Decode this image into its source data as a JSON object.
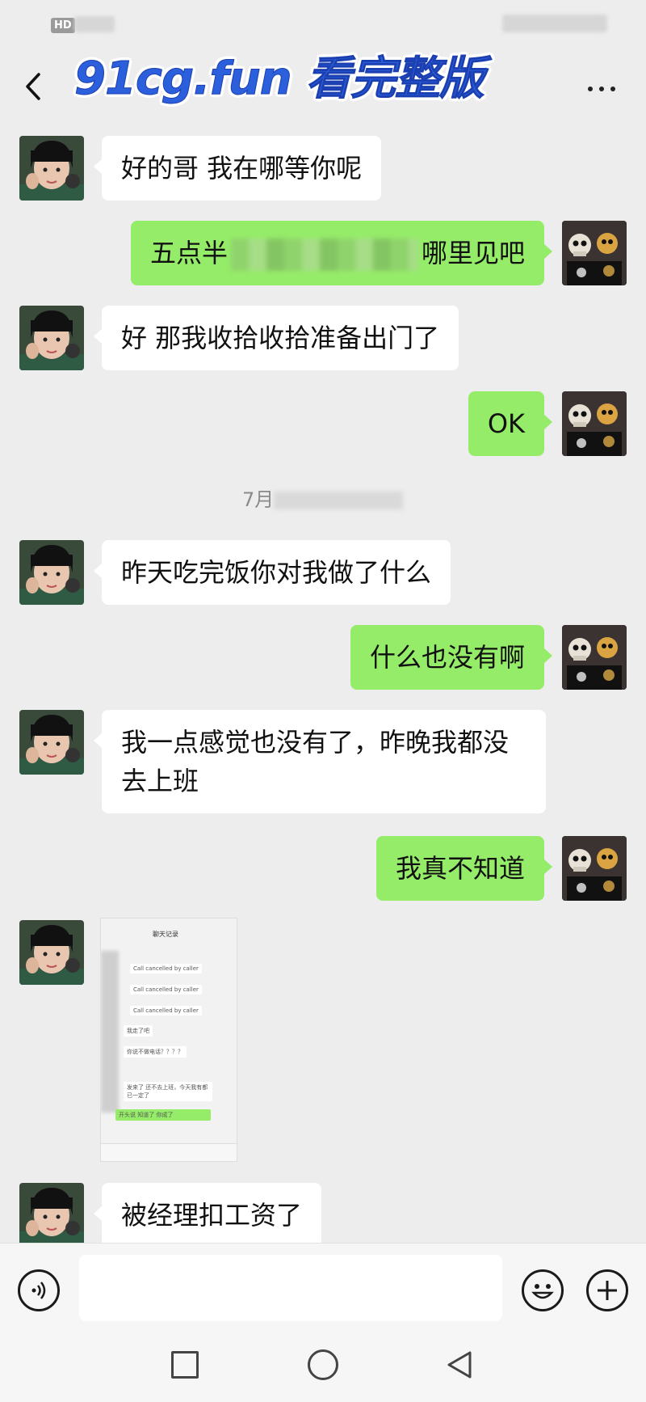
{
  "status_bar": {
    "hd": "HD"
  },
  "header": {
    "watermark": "91cg.fun 看完整版"
  },
  "messages": [
    {
      "side": "left",
      "text": "好的哥 我在哪等你呢"
    },
    {
      "side": "right",
      "text_before": "五点半",
      "text_after": "哪里见吧"
    },
    {
      "side": "left",
      "text": "好 那我收拾收拾准备出门了"
    },
    {
      "side": "right",
      "text": "OK"
    },
    {
      "side": "left",
      "text": "昨天吃完饭你对我做了什么"
    },
    {
      "side": "right",
      "text": "什么也没有啊"
    },
    {
      "side": "left",
      "text": "我一点感觉也没有了，昨晚我都没去上班"
    },
    {
      "side": "right",
      "text": "我真不知道"
    },
    {
      "side": "left",
      "text": "被经理扣工资了"
    }
  ],
  "timestamp": {
    "prefix": "7月"
  },
  "image_message": {
    "title": "聊天记录",
    "lines": [
      "Call cancelled by caller",
      "Call cancelled by caller",
      "Call cancelled by caller",
      "我走了吧",
      "你说不做电话？？？？",
      "发来了 还不去上班，今天我有都 已一定了",
      "开头说 知道了 你成了"
    ]
  },
  "colors": {
    "bubble_self": "#95ec69",
    "bubble_other": "#ffffff",
    "background": "#ededed",
    "watermark": "#2b5fdb"
  }
}
